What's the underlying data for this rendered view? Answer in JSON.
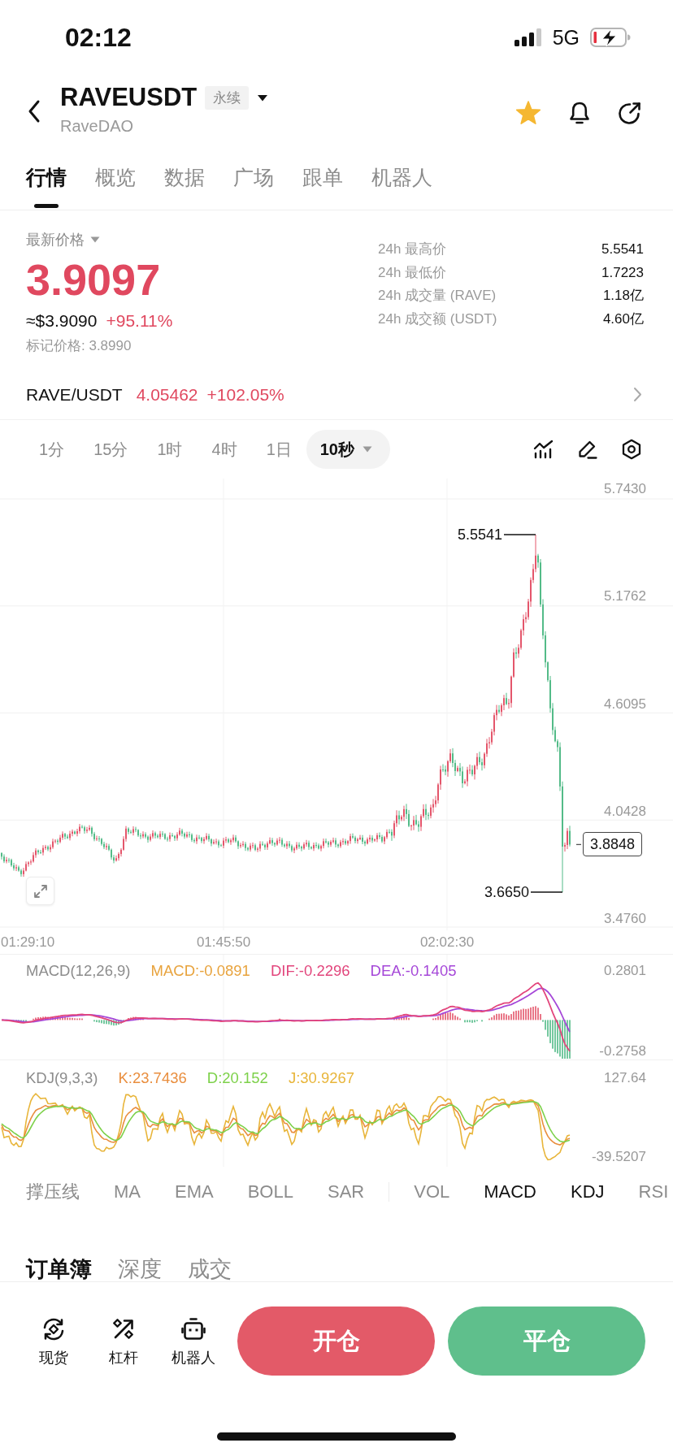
{
  "status_bar": {
    "time": "02:12",
    "network": "5G"
  },
  "header": {
    "title": "RAVEUSDT",
    "badge": "永续",
    "subtitle": "RaveDAO",
    "favorited": true
  },
  "tabs": [
    {
      "label": "行情",
      "selected": true
    },
    {
      "label": "概览",
      "selected": false
    },
    {
      "label": "数据",
      "selected": false
    },
    {
      "label": "广场",
      "selected": false
    },
    {
      "label": "跟单",
      "selected": false
    },
    {
      "label": "机器人",
      "selected": false
    }
  ],
  "price": {
    "label": "最新价格",
    "last": "3.9097",
    "usd": "≈$3.9090",
    "change": "+95.11%",
    "mark": "标记价格: 3.8990"
  },
  "stats": [
    {
      "label": "24h 最高价",
      "value": "5.5541"
    },
    {
      "label": "24h 最低价",
      "value": "1.7223"
    },
    {
      "label": "24h 成交量 (RAVE)",
      "value": "1.18亿"
    },
    {
      "label": "24h 成交额 (USDT)",
      "value": "4.60亿"
    }
  ],
  "spot_pair": {
    "name": "RAVE/USDT",
    "price": "4.05462",
    "change": "+102.05%"
  },
  "intervals": [
    {
      "label": "1分",
      "selected": false
    },
    {
      "label": "15分",
      "selected": false
    },
    {
      "label": "1时",
      "selected": false
    },
    {
      "label": "4时",
      "selected": false
    },
    {
      "label": "1日",
      "selected": false
    },
    {
      "label": "10秒",
      "selected": true
    }
  ],
  "price_chart": {
    "y_labels": [
      "5.7430",
      "5.1762",
      "4.6095",
      "4.0428",
      "3.4760"
    ],
    "high": "5.5541",
    "low": "3.6650",
    "current": "3.8848",
    "time_labels": [
      "01:29:10",
      "01:45:50",
      "02:02:30"
    ]
  },
  "macd": {
    "title": "MACD(12,26,9)",
    "legend": [
      {
        "label": "MACD:-0.0891",
        "color": "#e8a33d"
      },
      {
        "label": "DIF:-0.2296",
        "color": "#e2457c"
      },
      {
        "label": "DEA:-0.1405",
        "color": "#a547d8"
      }
    ],
    "y_labels": [
      "0.2801",
      "-0.2758"
    ]
  },
  "kdj": {
    "title": "KDJ(9,3,3)",
    "legend": [
      {
        "label": "K:23.7436",
        "color": "#e98e3e"
      },
      {
        "label": "D:20.152",
        "color": "#7dd14a"
      },
      {
        "label": "J:30.9267",
        "color": "#e8b53a"
      }
    ],
    "y_labels": [
      "127.64",
      "-39.5207"
    ]
  },
  "indicators": {
    "main": [
      {
        "label": "撑压线",
        "selected": false
      },
      {
        "label": "MA",
        "selected": false
      },
      {
        "label": "EMA",
        "selected": false
      },
      {
        "label": "BOLL",
        "selected": false
      },
      {
        "label": "SAR",
        "selected": false
      }
    ],
    "sub": [
      {
        "label": "VOL",
        "selected": false
      },
      {
        "label": "MACD",
        "selected": true
      },
      {
        "label": "KDJ",
        "selected": true
      },
      {
        "label": "RSI",
        "selected": false
      }
    ]
  },
  "book_tabs": [
    {
      "label": "订单簿",
      "selected": true
    },
    {
      "label": "深度",
      "selected": false
    },
    {
      "label": "成交",
      "selected": false
    }
  ],
  "bottom_bar": {
    "shortcuts": [
      {
        "kind": "spot",
        "label": "现货"
      },
      {
        "kind": "leverage",
        "label": "杠杆"
      },
      {
        "kind": "bot",
        "label": "机器人"
      }
    ],
    "buttons": [
      {
        "kind": "open",
        "label": "开仓"
      },
      {
        "kind": "close",
        "label": "平仓"
      }
    ]
  }
}
